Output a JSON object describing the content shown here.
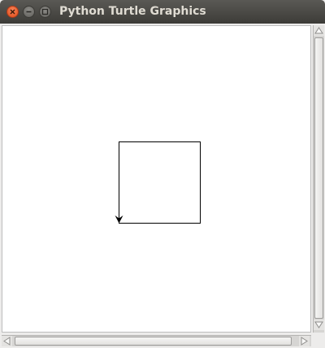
{
  "window": {
    "title": "Python Turtle Graphics",
    "buttons": {
      "close_icon": "close-icon",
      "minimize_icon": "minimize-icon",
      "maximize_icon": "maximize-icon"
    }
  },
  "canvas": {
    "background": "#ffffff",
    "pen_color": "#000000",
    "drawing": "square outline",
    "turtle_heading": "down"
  },
  "scrollbars": {
    "vertical": {
      "up_icon": "scroll-up-arrow-icon",
      "down_icon": "scroll-down-arrow-icon"
    },
    "horizontal": {
      "left_icon": "scroll-left-arrow-icon",
      "right_icon": "scroll-right-arrow-icon"
    }
  },
  "colors": {
    "titlebar": "#3c3b37",
    "title_text": "#dfdbd2",
    "close_button": "#df4a16"
  }
}
